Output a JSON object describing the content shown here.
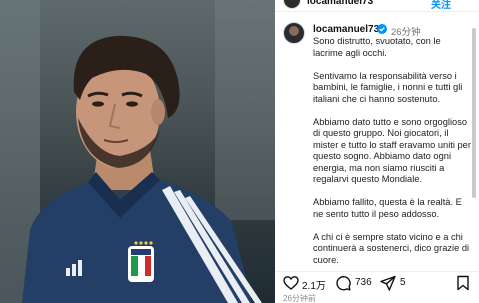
{
  "photo": {
    "alt_subject": "player-photo"
  },
  "topbar": {
    "username": "locamanuel73",
    "follow_label": "关注"
  },
  "post": {
    "username": "locamanuel73",
    "time": "26分钟",
    "caption": [
      "Sono distrutto, svuotato, con le lacrime agli occhi.",
      "Sentivamo la responsabilità verso i bambini, le famiglie, i nonni e tutti gli italiani che ci hanno sostenuto.",
      "Abbiamo dato tutto e sono orgoglioso di questo gruppo. Noi giocatori, il mister e tutto lo staff eravamo uniti per questo sogno. Abbiamo dato ogni energia, ma non siamo riusciti a regalarvi questo Mondiale.",
      "Abbiamo fallito, questa è la realtà. E ne sento tutto il peso addosso.",
      "A chi ci è sempre stato vicino e a chi continuerà a sostenerci, dico grazie di cuore."
    ]
  },
  "actions": {
    "likes": "2.1万",
    "comments": "736",
    "shares": "5"
  },
  "footer": {
    "time": "26分钟前"
  },
  "colors": {
    "link_blue": "#0095f6",
    "jersey": "#1f3f6e"
  }
}
